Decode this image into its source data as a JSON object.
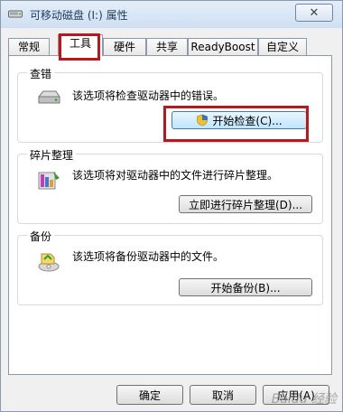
{
  "window": {
    "title": "可移动磁盘 (I:) 属性",
    "close_symbol": "✕"
  },
  "tabs": [
    {
      "label": "常规"
    },
    {
      "label": "工具"
    },
    {
      "label": "硬件"
    },
    {
      "label": "共享"
    },
    {
      "label": "ReadyBoost"
    },
    {
      "label": "自定义"
    }
  ],
  "active_tab": "工具",
  "groups": {
    "check": {
      "title": "查错",
      "description": "该选项将检查驱动器中的错误。",
      "button": "开始检查(C)..."
    },
    "defrag": {
      "title": "碎片整理",
      "description": "该选项将对驱动器中的文件进行碎片整理。",
      "button": "立即进行碎片整理(D)..."
    },
    "backup": {
      "title": "备份",
      "description": "该选项将备份驱动器中的文件。",
      "button": "开始备份(B)..."
    }
  },
  "footer": {
    "ok": "确定",
    "cancel": "取消",
    "apply": "应用(A)"
  },
  "watermark": "Baidu 经验",
  "colors": {
    "highlight": "#c0161b",
    "primary_button": "#bee6fd"
  }
}
